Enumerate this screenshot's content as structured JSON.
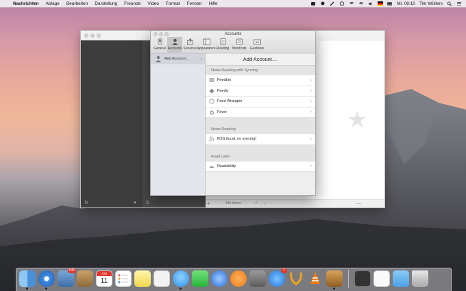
{
  "menubar": {
    "app_name": "Nachrichten",
    "items": [
      "Ablage",
      "Bearbeiten",
      "Darstellung",
      "Freunde",
      "Video",
      "Format",
      "Fenster",
      "Hilfe"
    ],
    "clock": "Mi. 08:10",
    "user": "Tim Wüllers"
  },
  "prefs": {
    "title": "Accounts",
    "toolbar": [
      "General",
      "Accounts",
      "Services",
      "Appearance",
      "Reading",
      "Shortcuts",
      "Gestures"
    ],
    "active_tab": "Accounts",
    "sidebar_item": "Add Account...",
    "header": "Add Account....",
    "sections": [
      {
        "title": "News Reading with Syncing",
        "rows": [
          "Feedbin",
          "Feedly",
          "Feed Wrangler",
          "Fever"
        ]
      },
      {
        "title": "News Reading",
        "rows": [
          "RSS (local, no syncing)"
        ]
      },
      {
        "title": "Read Later",
        "rows": [
          "Readability"
        ]
      }
    ]
  },
  "reeder": {
    "status": "No items"
  },
  "dock": {
    "badges": {
      "photos": "645",
      "calendar_day": "11",
      "appstore": "1"
    },
    "calendar_month": "JUN"
  }
}
